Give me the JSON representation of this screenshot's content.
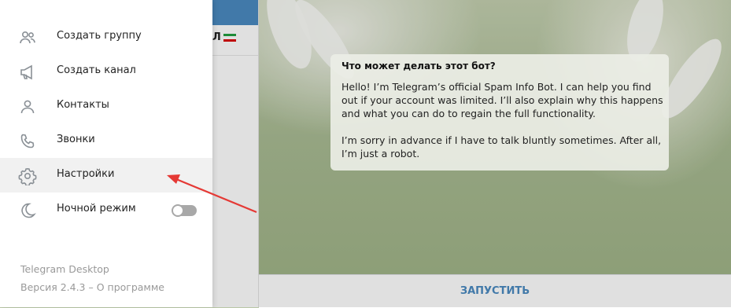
{
  "menu": {
    "items": [
      {
        "label": "Создать группу",
        "icon": "group-icon"
      },
      {
        "label": "Создать канал",
        "icon": "megaphone-icon"
      },
      {
        "label": "Контакты",
        "icon": "person-icon"
      },
      {
        "label": "Звонки",
        "icon": "phone-icon"
      },
      {
        "label": "Настройки",
        "icon": "gear-icon"
      },
      {
        "label": "Ночной режим",
        "icon": "moon-icon"
      }
    ],
    "night_mode_on": false,
    "footer_app": "Telegram Desktop",
    "footer_version_prefix": "Версия 2.4.3 – ",
    "footer_about": "О программе"
  },
  "chat_list": {
    "partial_name": "Л"
  },
  "bot_info": {
    "title": "Что может делать этот бот?",
    "body": "Hello! I’m Telegram’s official Spam Info Bot. I can help you find out if your account was limited. I’ll also explain why this happens and what you can do to regain the full functionality.\n\nI’m sorry in advance if I have to talk bluntly sometimes. After all, I’m just a robot."
  },
  "composer": {
    "start_label": "ЗАПУСТИТЬ"
  },
  "colors": {
    "accent": "#4a8ac1",
    "annotation_arrow": "#e53935"
  }
}
